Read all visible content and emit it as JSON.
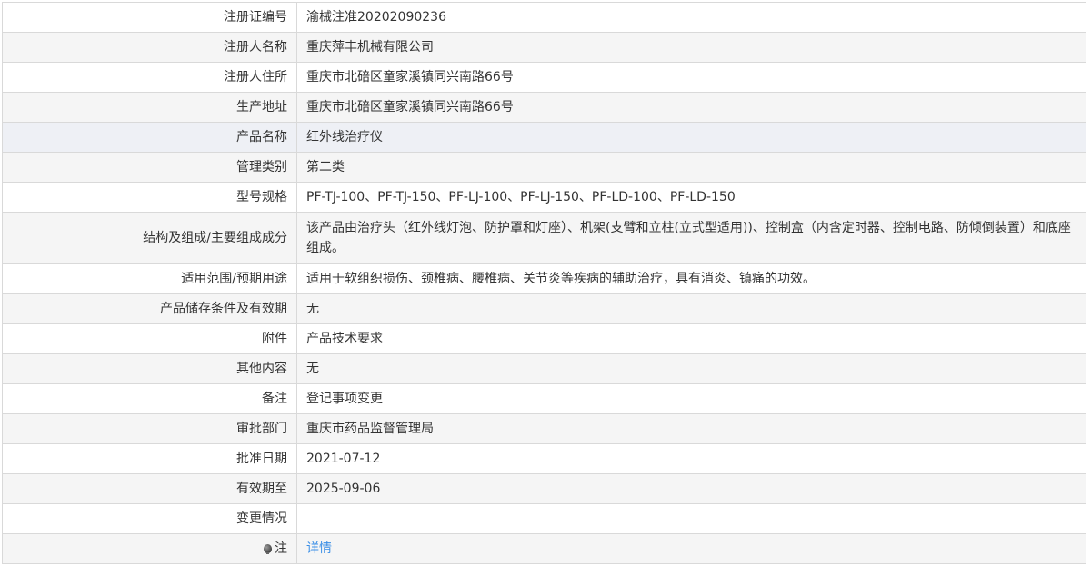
{
  "record": {
    "registration_no": {
      "label": "注册证编号",
      "value": "渝械注准20202090236"
    },
    "registrant_name": {
      "label": "注册人名称",
      "value": "重庆萍丰机械有限公司"
    },
    "registrant_address": {
      "label": "注册人住所",
      "value": "重庆市北碚区童家溪镇同兴南路66号"
    },
    "production_address": {
      "label": "生产地址",
      "value": "重庆市北碚区童家溪镇同兴南路66号"
    },
    "product_name": {
      "label": "产品名称",
      "value": "红外线治疗仪"
    },
    "management_class": {
      "label": "管理类别",
      "value": "第二类"
    },
    "model_spec": {
      "label": "型号规格",
      "value": "PF-TJ-100、PF-TJ-150、PF-LJ-100、PF-LJ-150、PF-LD-100、PF-LD-150"
    },
    "structure": {
      "label": "结构及组成/主要组成成分",
      "value": "该产品由治疗头（红外线灯泡、防护罩和灯座）、机架(支臂和立柱(立式型适用))、控制盒（内含定时器、控制电路、防倾倒装置）和底座组成。"
    },
    "scope": {
      "label": "适用范围/预期用途",
      "value": "适用于软组织损伤、颈椎病、腰椎病、关节炎等疾病的辅助治疗，具有消炎、镇痛的功效。"
    },
    "storage": {
      "label": "产品储存条件及有效期",
      "value": "无"
    },
    "attachment": {
      "label": "附件",
      "value": "产品技术要求"
    },
    "other": {
      "label": "其他内容",
      "value": "无"
    },
    "remarks": {
      "label": "备注",
      "value": "登记事项变更"
    },
    "approval_dept": {
      "label": "审批部门",
      "value": "重庆市药品监督管理局"
    },
    "approval_date": {
      "label": "批准日期",
      "value": "2021-07-12"
    },
    "valid_until": {
      "label": "有效期至",
      "value": "2025-09-06"
    },
    "change_info": {
      "label": "变更情况",
      "value": ""
    },
    "note": {
      "label": "注",
      "icon": "lightbulb-icon",
      "link_text": "详情"
    }
  },
  "colors": {
    "border": "#d9d9d9",
    "row_alt": "#f5f5f5",
    "text": "#333333",
    "link": "#3a8ee6"
  }
}
